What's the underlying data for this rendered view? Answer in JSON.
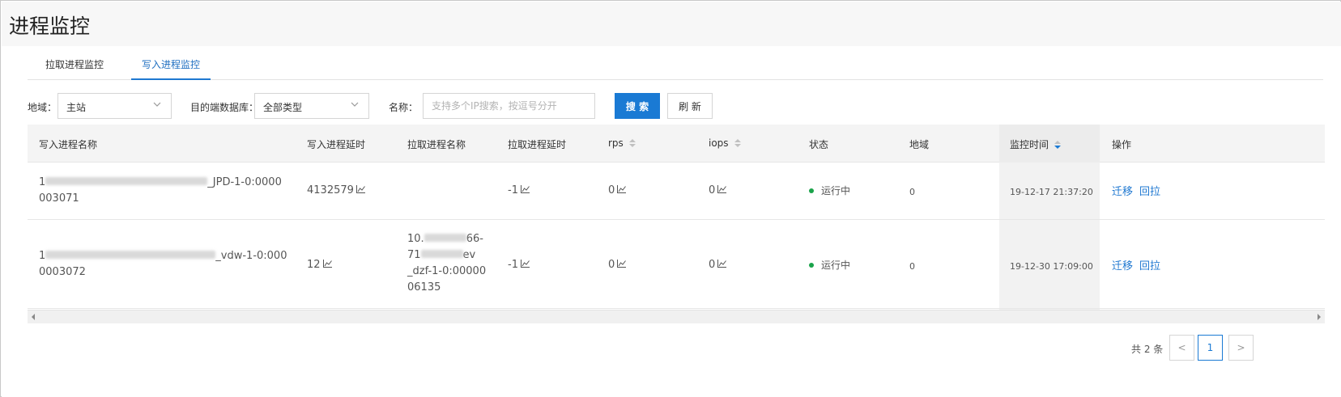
{
  "page": {
    "title": "进程监控"
  },
  "tabs": [
    {
      "label": "拉取进程监控",
      "active": false
    },
    {
      "label": "写入进程监控",
      "active": true
    }
  ],
  "filters": {
    "region_label": "地域：",
    "region_value": "主站",
    "db_label": "目的端数据库：",
    "db_value": "全部类型",
    "name_label": "名称：",
    "name_placeholder": "支持多个IP搜索，按逗号分开",
    "search_label": "搜 索",
    "refresh_label": "刷 新"
  },
  "table": {
    "columns": [
      "写入进程名称",
      "写入进程延时",
      "拉取进程名称",
      "拉取进程延时",
      "rps",
      "iops",
      "状态",
      "地域",
      "监控时间",
      "操作"
    ],
    "rows": [
      {
        "write_name_l1_pre": "1",
        "write_name_l1_post": "_JPD-1-0:0000",
        "write_name_l2": "003071",
        "write_delay": "4132579",
        "pull_name": [],
        "pull_delay": "-1",
        "rps": "0",
        "iops": "0",
        "status": "运行中",
        "region": "0",
        "time": "19-12-17 21:37:20",
        "actions": [
          "迁移",
          "回拉"
        ]
      },
      {
        "write_name_l1_pre": "1",
        "write_name_l1_post": "_vdw-1-0:000",
        "write_name_l2": "0003072",
        "write_delay": "12",
        "pull_name": [
          "10.",
          "66-",
          "71",
          "ev",
          "_dzf-1-0:00000",
          "06135"
        ],
        "pull_delay": "-1",
        "rps": "0",
        "iops": "0",
        "status": "运行中",
        "region": "0",
        "time": "19-12-30 17:09:00",
        "actions": [
          "迁移",
          "回拉"
        ]
      }
    ]
  },
  "pagination": {
    "total_text": "共 2 条",
    "current_page": "1",
    "prev": "<",
    "next": ">"
  },
  "colors": {
    "primary": "#1a7ad4",
    "status_ok": "#1aa34a",
    "link": "#1f78d1"
  }
}
